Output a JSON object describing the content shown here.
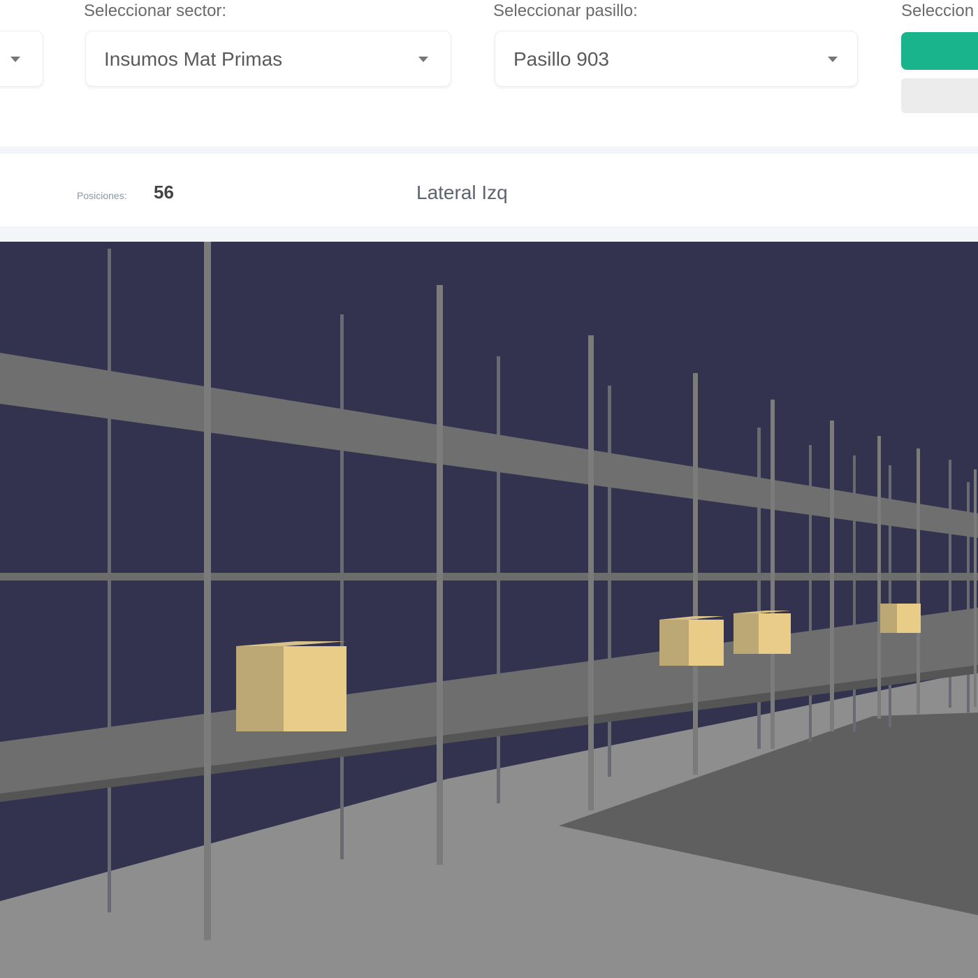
{
  "filters": {
    "sector": {
      "label": "Seleccionar sector:",
      "value": "Insumos Mat Primas"
    },
    "pasillo": {
      "label": "Seleccionar pasillo:",
      "value": "Pasillo 903"
    },
    "third": {
      "label": "Seleccion"
    }
  },
  "info": {
    "positions_label": "Posiciones:",
    "positions_value": "56",
    "side": "Lateral Izq"
  },
  "scene": {
    "background_color": "#33334f",
    "shelf_color": "#7a7a7a",
    "box_color": "#e8cc88",
    "floor_color": "#8e8e8e",
    "boxes_visible": 4
  },
  "colors": {
    "accent": "#19b38c"
  }
}
